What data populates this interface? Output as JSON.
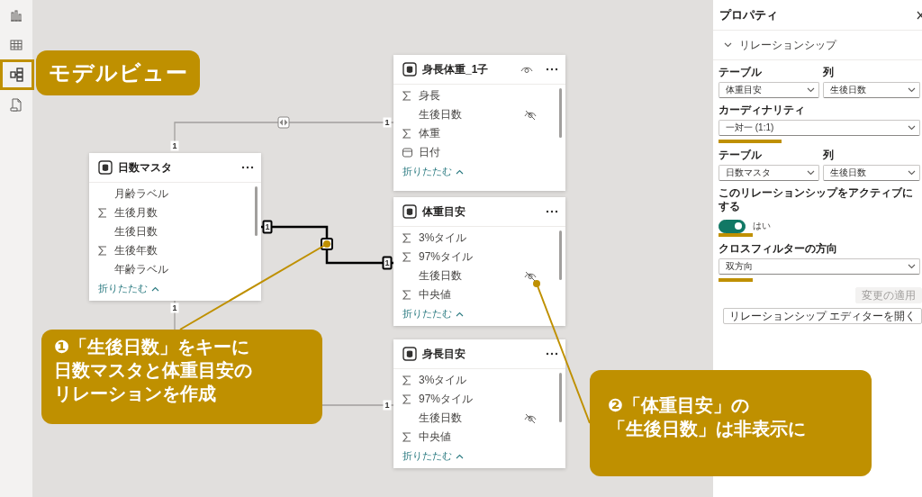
{
  "rail": {
    "items": [
      {
        "kind": "report",
        "highlighted": false
      },
      {
        "kind": "table",
        "highlighted": false
      },
      {
        "kind": "model",
        "highlighted": true
      },
      {
        "kind": "dax",
        "highlighted": false
      }
    ]
  },
  "canvas": {
    "tables": [
      {
        "name": "日数マスタ",
        "visibility_icon": false,
        "collapse": "折りたたむ",
        "fields": [
          {
            "name": "月齢ラベル",
            "kind": "text",
            "hidden": false
          },
          {
            "name": "生後月数",
            "kind": "measure",
            "hidden": false
          },
          {
            "name": "生後日数",
            "kind": "text",
            "hidden": false
          },
          {
            "name": "生後年数",
            "kind": "measure",
            "hidden": false
          },
          {
            "name": "年齢ラベル",
            "kind": "text",
            "hidden": false
          }
        ]
      },
      {
        "name": "身長体重_1子",
        "visibility_icon": true,
        "collapse": "折りたたむ",
        "fields": [
          {
            "name": "身長",
            "kind": "measure",
            "hidden": false
          },
          {
            "name": "生後日数",
            "kind": "text",
            "hidden": true
          },
          {
            "name": "体重",
            "kind": "measure",
            "hidden": false
          },
          {
            "name": "日付",
            "kind": "date",
            "hidden": false
          }
        ]
      },
      {
        "name": "体重目安",
        "visibility_icon": false,
        "collapse": "折りたたむ",
        "fields": [
          {
            "name": "3%タイル",
            "kind": "measure",
            "hidden": false
          },
          {
            "name": "97%タイル",
            "kind": "measure",
            "hidden": false
          },
          {
            "name": "生後日数",
            "kind": "text",
            "hidden": true
          },
          {
            "name": "中央値",
            "kind": "measure",
            "hidden": false
          }
        ]
      },
      {
        "name": "身長目安",
        "visibility_icon": false,
        "collapse": "折りたたむ",
        "fields": [
          {
            "name": "3%タイル",
            "kind": "measure",
            "hidden": false
          },
          {
            "name": "97%タイル",
            "kind": "measure",
            "hidden": false
          },
          {
            "name": "生後日数",
            "kind": "text",
            "hidden": true
          },
          {
            "name": "中央値",
            "kind": "measure",
            "hidden": false
          }
        ]
      }
    ],
    "relationships": [
      {
        "active": false,
        "ends": [
          "1",
          "1"
        ]
      },
      {
        "active": true,
        "ends": [
          "1",
          "1"
        ]
      },
      {
        "active": false,
        "ends": [
          "1",
          "1"
        ]
      }
    ]
  },
  "annotations": [
    {
      "kind": "label",
      "lines": [
        "モデルビュー"
      ]
    },
    {
      "kind": "callout",
      "lines": [
        "❶「生後日数」をキーに",
        "日数マスタと体重目安の",
        "リレーションを作成"
      ]
    },
    {
      "kind": "callout",
      "lines": [
        "❷「体重目安」の",
        "「生後日数」は非表示に"
      ]
    }
  ],
  "properties": {
    "title": "プロパティ",
    "section": "リレーションシップ",
    "from": {
      "table_label": "テーブル",
      "column_label": "列",
      "table": "体重目安",
      "column": "生後日数"
    },
    "cardinality": {
      "label": "カーディナリティ",
      "value": "一対一 (1:1)",
      "highlighted": true
    },
    "to": {
      "table_label": "テーブル",
      "column_label": "列",
      "table": "日数マスタ",
      "column": "生後日数"
    },
    "active": {
      "label": "このリレーションシップをアクティブにする",
      "on": true,
      "value": "はい",
      "highlighted": true
    },
    "crossfilter": {
      "label": "クロスフィルターの方向",
      "value": "双方向",
      "highlighted": true
    },
    "buttons": [
      {
        "label": "変更の適用",
        "disabled": true
      },
      {
        "label": "リレーションシップ エディターを開く",
        "disabled": false
      }
    ]
  }
}
